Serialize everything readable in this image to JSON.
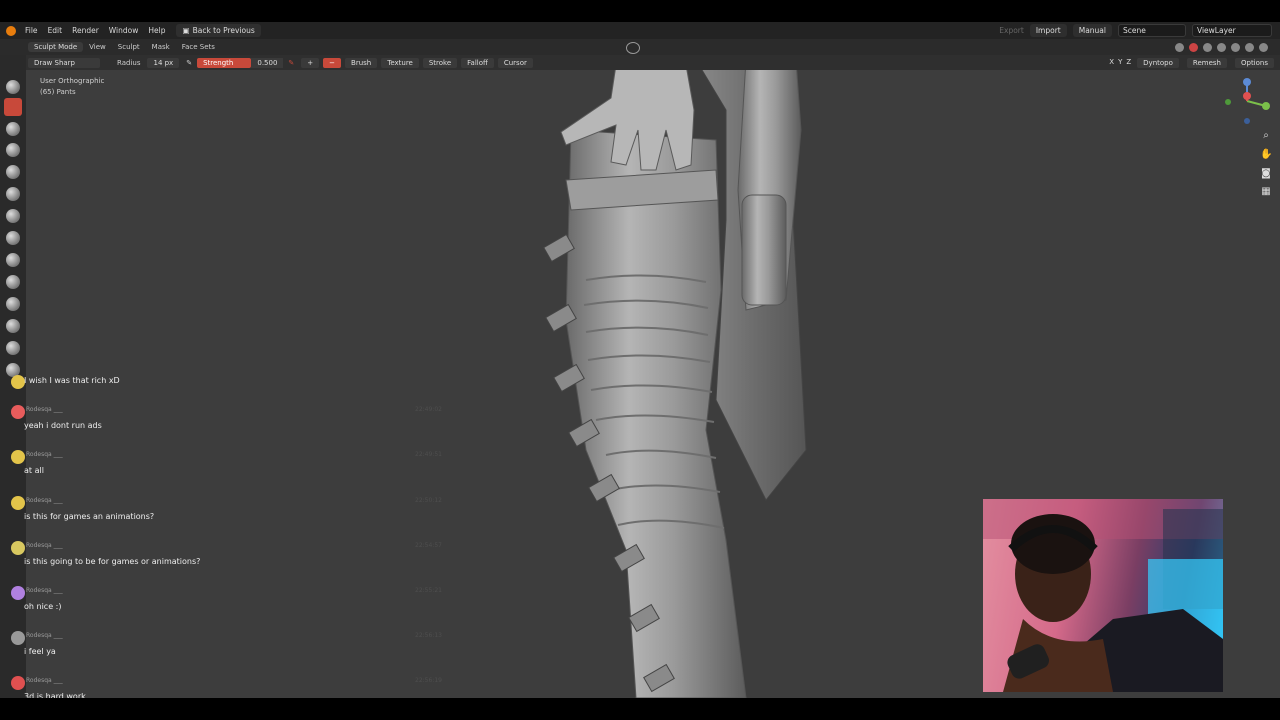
{
  "menubar": {
    "items": [
      "File",
      "Edit",
      "Render",
      "Window",
      "Help"
    ],
    "back_button": "Back to Previous",
    "workspace_disabled": "Export",
    "import": "Import",
    "manual": "Manual",
    "scene": "Scene",
    "view_layer": "ViewLayer"
  },
  "header": {
    "mode": "Sculpt Mode",
    "items": [
      "View",
      "Sculpt",
      "Mask",
      "Face Sets"
    ]
  },
  "tool_settings": {
    "brush_name": "Draw Sharp",
    "radius_label": "Radius",
    "radius_value": "14 px",
    "strength_label": "Strength",
    "strength_value": "0.500",
    "plus": "+",
    "minus": "−",
    "brush_dd": "Brush",
    "texture_dd": "Texture",
    "stroke_dd": "Stroke",
    "falloff_dd": "Falloff",
    "cursor_dd": "Cursor",
    "x": "X",
    "y": "Y",
    "z": "Z",
    "dyntopo": "Dyntopo",
    "remesh": "Remesh",
    "options": "Options"
  },
  "viewport": {
    "view_name": "User Orthographic",
    "object": "(65) Pants"
  },
  "chat": [
    {
      "user": "",
      "message": "I wish I was that rich xD",
      "time": "",
      "avatar_color": "#e3c44a"
    },
    {
      "user": "Rodesqa ___",
      "message": "yeah i dont run ads",
      "time": "22:49:02",
      "avatar_color": "#e85c5c"
    },
    {
      "user": "Rodesqa ___",
      "message": "at all",
      "time": "22:49:51",
      "avatar_color": "#e3c44a"
    },
    {
      "user": "Rodesqa ___",
      "message": "is this for games an animations?",
      "time": "22:50:12",
      "avatar_color": "#e3c44a"
    },
    {
      "user": "Rodesqa ___",
      "message": "is this going to be for games or animations?",
      "time": "22:54:57",
      "avatar_color": "#d8c860"
    },
    {
      "user": "Rodesqa ___",
      "message": "oh nice :)",
      "time": "22:55:21",
      "avatar_color": "#b080e0"
    },
    {
      "user": "Rodesqa ___",
      "message": "i feel ya",
      "time": "22:56:13",
      "avatar_color": "#999999"
    },
    {
      "user": "Rodesqa ___",
      "message": "3d is hard work",
      "time": "22:56:19",
      "avatar_color": "#e05050"
    }
  ],
  "colors": {
    "accent": "#c8493a",
    "viewport_bg": "#3d3d3d",
    "header_bg": "#2b2b2b"
  }
}
